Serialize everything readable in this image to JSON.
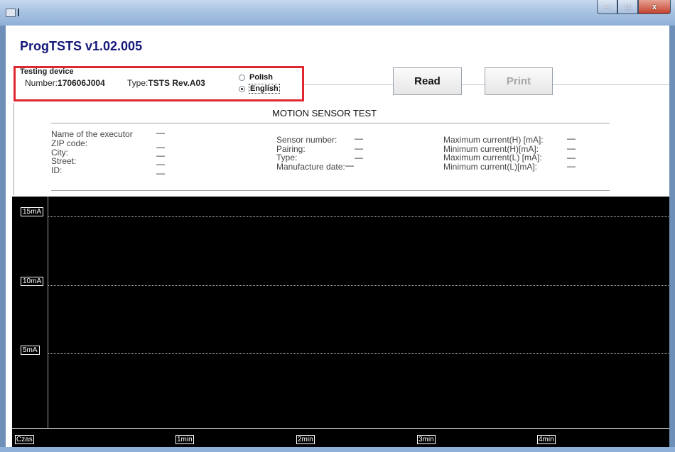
{
  "window": {
    "minimize": "–",
    "maximize": "□",
    "close": "x"
  },
  "app_title": "ProgTSTS v1.02.005",
  "device": {
    "title": "Testing device",
    "number_label": "Number:",
    "number_value": "170606J004",
    "type_label": "Type:",
    "type_value": "TSTS Rev.A03",
    "languages": [
      {
        "label": "Polish",
        "selected": false
      },
      {
        "label": "English",
        "selected": true
      }
    ]
  },
  "buttons": {
    "read": "Read",
    "print": "Print"
  },
  "report": {
    "title": "MOTION SENSOR TEST",
    "executor_fields": [
      {
        "label": "Name of the executor",
        "value": "—"
      },
      {
        "label": "ZIP code:",
        "value": "—"
      },
      {
        "label": "City:",
        "value": "—"
      },
      {
        "label": "Street:",
        "value": "—"
      },
      {
        "label": "ID:",
        "value": "—"
      }
    ],
    "sensor_fields": [
      {
        "label": "Sensor number:",
        "value": "—"
      },
      {
        "label": "Pairing:",
        "value": "—"
      },
      {
        "label": "Type:",
        "value": "—"
      },
      {
        "label": "Manufacture date:",
        "value": "—"
      }
    ],
    "current_fields": [
      {
        "label": "Maximum current(H) [mA]:",
        "value": "—"
      },
      {
        "label": "Minimum current(H)[mA]:",
        "value": "—"
      },
      {
        "label": "Maximum current(L) [mA]:",
        "value": "—"
      },
      {
        "label": "Minimum current(L)[mA]:",
        "value": "—"
      }
    ]
  },
  "graph": {
    "y_labels": [
      "15mA",
      "10mA",
      "5mA"
    ],
    "x_labels": [
      "Czas",
      "1min",
      "2min",
      "3min",
      "4min"
    ]
  }
}
